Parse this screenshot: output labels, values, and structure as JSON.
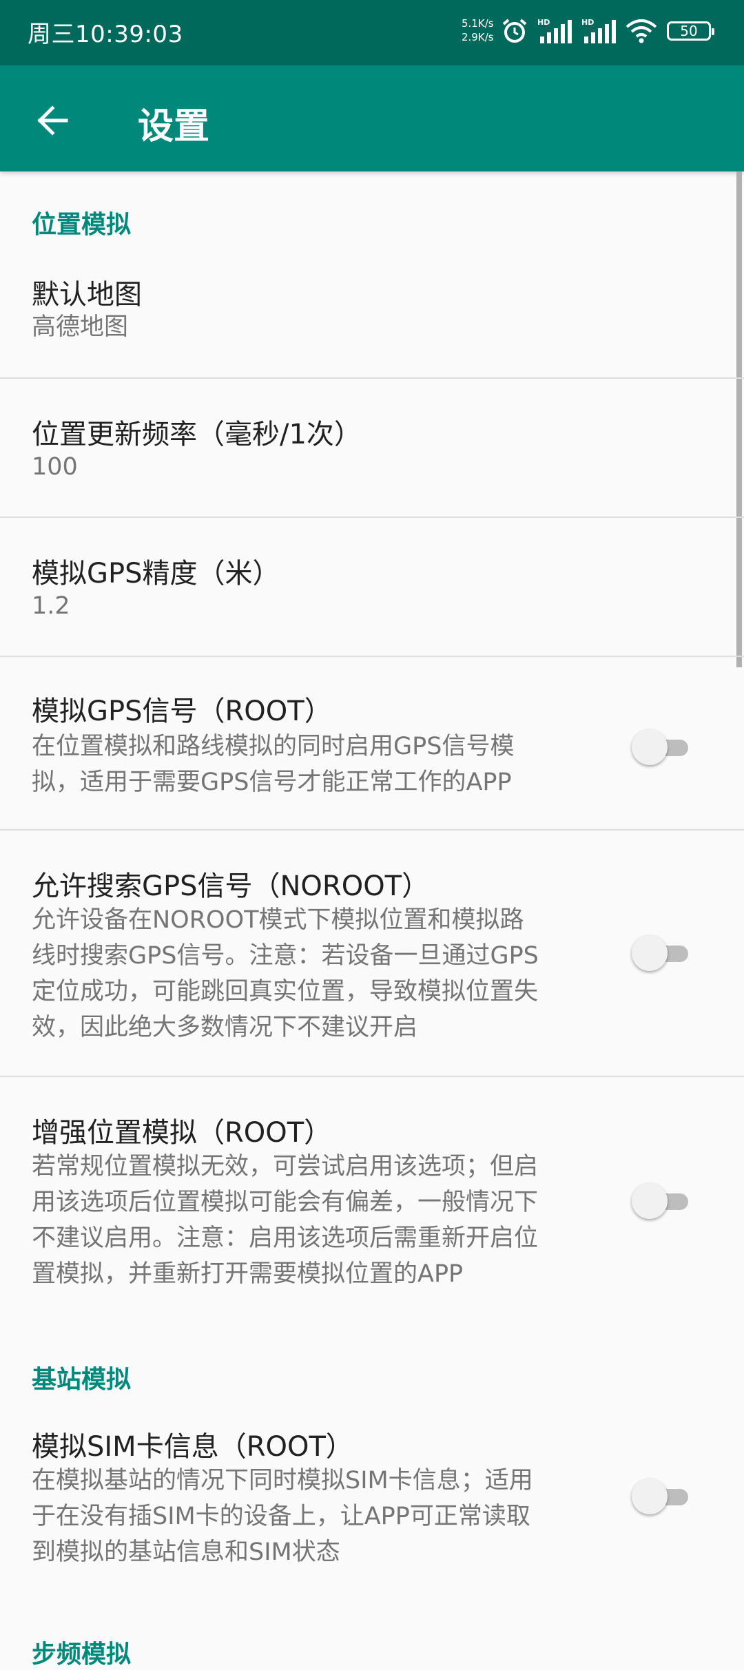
{
  "status_bar": {
    "time": "周三10:39:03",
    "speed_up": "5.1K/s",
    "speed_down": "2.9K/s",
    "battery": "50",
    "icons": [
      "alarm-icon",
      "hd-signal-icon",
      "hd-signal-icon",
      "wifi-icon",
      "battery-icon"
    ]
  },
  "app_bar": {
    "title": "设置",
    "back_icon": "arrow-left-icon"
  },
  "colors": {
    "status_bar": "#00695c",
    "app_bar": "#00897b",
    "accent": "#00897b"
  },
  "categories": {
    "location": "位置模拟",
    "cell": "基站模拟",
    "step": "步频模拟"
  },
  "prefs": {
    "default_map": {
      "title": "默认地图",
      "summary": "高德地图"
    },
    "update_rate": {
      "title": "位置更新频率（毫秒/1次）",
      "summary": "100"
    },
    "gps_accuracy": {
      "title": "模拟GPS精度（米）",
      "summary": "1.2"
    },
    "gps_signal": {
      "title": "模拟GPS信号（ROOT）",
      "summary_lines": [
        "在位置模拟和路线模拟的同时启用GPS信号模",
        "拟，适用于需要GPS信号才能正常工作的APP"
      ],
      "enabled": false
    },
    "search_gps": {
      "title": "允许搜索GPS信号（NOROOT）",
      "summary_lines": [
        "允许设备在NOROOT模式下模拟位置和模拟路",
        "线时搜索GPS信号。注意：若设备一旦通过GPS",
        "定位成功，可能跳回真实位置，导致模拟位置失",
        "效，因此绝大多数情况下不建议开启"
      ],
      "enabled": false
    },
    "enhanced": {
      "title": "增强位置模拟（ROOT）",
      "summary_lines": [
        "若常规位置模拟无效，可尝试启用该选项；但启",
        "用该选项后位置模拟可能会有偏差，一般情况下",
        "不建议启用。注意：启用该选项后需重新开启位",
        "置模拟，并重新打开需要模拟位置的APP"
      ],
      "enabled": false
    },
    "sim_info": {
      "title": "模拟SIM卡信息（ROOT）",
      "summary_lines": [
        "在模拟基站的情况下同时模拟SIM卡信息；适用",
        "于在没有插SIM卡的设备上，让APP可正常读取",
        "到模拟的基站信息和SIM状态"
      ],
      "enabled": false
    }
  }
}
